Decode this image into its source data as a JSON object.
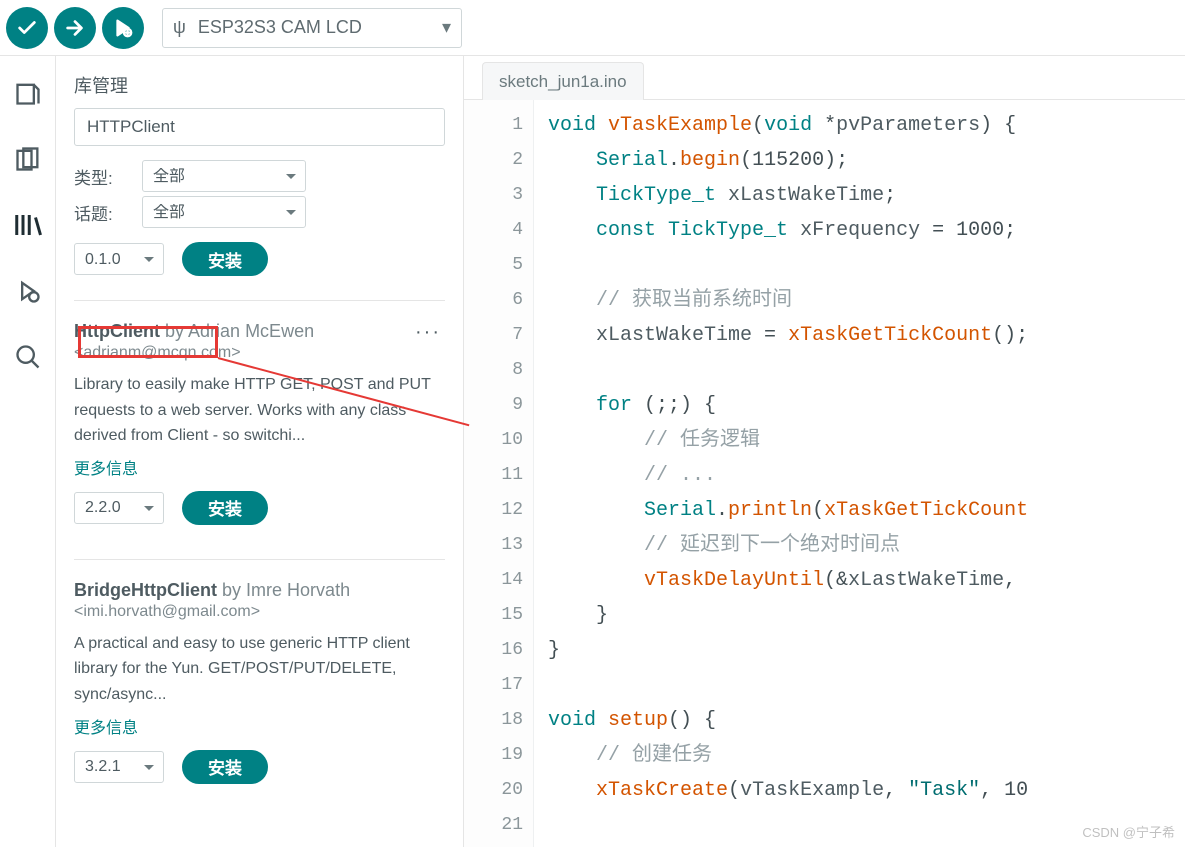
{
  "toolbar": {
    "board_name": "ESP32S3 CAM LCD"
  },
  "sidebar": {
    "title": "库管理",
    "search_value": "HTTPClient",
    "type_label": "类型:",
    "type_value": "全部",
    "topic_label": "话题:",
    "topic_value": "全部",
    "top_version": "0.1.0",
    "install_label": "安装",
    "libs": [
      {
        "name": "HttpClient",
        "by": "by",
        "author": "Adrian McEwen",
        "email": "<adrianm@mcqn.com>",
        "desc": "Library to easily make HTTP GET, POST and PUT requests to a web server. Works with any class derived from Client - so switchi...",
        "more": "更多信息",
        "version": "2.2.0"
      },
      {
        "name": "BridgeHttpClient",
        "by": "by",
        "author": "Imre Horvath",
        "email": "<imi.horvath@gmail.com>",
        "desc": "A practical and easy to use generic HTTP client library for the Yun. GET/POST/PUT/DELETE, sync/async...",
        "more": "更多信息",
        "version": "3.2.1"
      }
    ]
  },
  "editor": {
    "tab": "sketch_jun1a.ino",
    "lines": [
      {
        "n": 1,
        "tokens": [
          {
            "t": "void ",
            "c": "kw"
          },
          {
            "t": "vTaskExample",
            "c": "fn"
          },
          {
            "t": "(",
            "c": "op"
          },
          {
            "t": "void ",
            "c": "kw"
          },
          {
            "t": "*",
            "c": "op"
          },
          {
            "t": "pvParameters",
            "c": "ident"
          },
          {
            "t": ") {",
            "c": "op"
          }
        ]
      },
      {
        "n": 2,
        "indent": 4,
        "tokens": [
          {
            "t": "Serial",
            "c": "type"
          },
          {
            "t": ".",
            "c": "op"
          },
          {
            "t": "begin",
            "c": "fn"
          },
          {
            "t": "(",
            "c": "op"
          },
          {
            "t": "115200",
            "c": "num"
          },
          {
            "t": ");",
            "c": "op"
          }
        ]
      },
      {
        "n": 3,
        "indent": 4,
        "tokens": [
          {
            "t": "TickType_t ",
            "c": "type"
          },
          {
            "t": "xLastWakeTime",
            "c": "ident"
          },
          {
            "t": ";",
            "c": "op"
          }
        ]
      },
      {
        "n": 4,
        "indent": 4,
        "tokens": [
          {
            "t": "const ",
            "c": "kw"
          },
          {
            "t": "TickType_t ",
            "c": "type"
          },
          {
            "t": "xFrequency",
            "c": "ident"
          },
          {
            "t": " = ",
            "c": "op"
          },
          {
            "t": "1000",
            "c": "num"
          },
          {
            "t": ";",
            "c": "op"
          }
        ]
      },
      {
        "n": 5,
        "tokens": []
      },
      {
        "n": 6,
        "indent": 4,
        "tokens": [
          {
            "t": "// 获取当前系统时间",
            "c": "cm"
          }
        ]
      },
      {
        "n": 7,
        "indent": 4,
        "tokens": [
          {
            "t": "xLastWakeTime",
            "c": "ident"
          },
          {
            "t": " = ",
            "c": "op"
          },
          {
            "t": "xTaskGetTickCount",
            "c": "fn"
          },
          {
            "t": "();",
            "c": "op"
          }
        ]
      },
      {
        "n": 8,
        "tokens": []
      },
      {
        "n": 9,
        "indent": 4,
        "tokens": [
          {
            "t": "for ",
            "c": "kw"
          },
          {
            "t": "(;;) {",
            "c": "op"
          }
        ]
      },
      {
        "n": 10,
        "indent": 8,
        "tokens": [
          {
            "t": "// 任务逻辑",
            "c": "cm"
          }
        ]
      },
      {
        "n": 11,
        "indent": 8,
        "tokens": [
          {
            "t": "// ...",
            "c": "cm"
          }
        ]
      },
      {
        "n": 12,
        "indent": 8,
        "tokens": [
          {
            "t": "Serial",
            "c": "type"
          },
          {
            "t": ".",
            "c": "op"
          },
          {
            "t": "println",
            "c": "fn"
          },
          {
            "t": "(",
            "c": "op"
          },
          {
            "t": "xTaskGetTickCount",
            "c": "fn"
          }
        ]
      },
      {
        "n": 13,
        "indent": 8,
        "tokens": [
          {
            "t": "// 延迟到下一个绝对时间点",
            "c": "cm"
          }
        ]
      },
      {
        "n": 14,
        "indent": 8,
        "tokens": [
          {
            "t": "vTaskDelayUntil",
            "c": "fn"
          },
          {
            "t": "(&",
            "c": "op"
          },
          {
            "t": "xLastWakeTime",
            "c": "ident"
          },
          {
            "t": ", ",
            "c": "op"
          }
        ]
      },
      {
        "n": 15,
        "indent": 4,
        "tokens": [
          {
            "t": "}",
            "c": "op"
          }
        ]
      },
      {
        "n": 16,
        "tokens": [
          {
            "t": "}",
            "c": "op"
          }
        ]
      },
      {
        "n": 17,
        "tokens": []
      },
      {
        "n": 18,
        "tokens": [
          {
            "t": "void ",
            "c": "kw"
          },
          {
            "t": "setup",
            "c": "fn"
          },
          {
            "t": "() {",
            "c": "op"
          }
        ]
      },
      {
        "n": 19,
        "indent": 4,
        "tokens": [
          {
            "t": "// 创建任务",
            "c": "cm"
          }
        ]
      },
      {
        "n": 20,
        "indent": 4,
        "tokens": [
          {
            "t": "xTaskCreate",
            "c": "fn"
          },
          {
            "t": "(",
            "c": "op"
          },
          {
            "t": "vTaskExample",
            "c": "ident"
          },
          {
            "t": ", ",
            "c": "op"
          },
          {
            "t": "\"Task\"",
            "c": "str"
          },
          {
            "t": ", ",
            "c": "op"
          },
          {
            "t": "10",
            "c": "num"
          }
        ]
      },
      {
        "n": 21,
        "tokens": []
      }
    ]
  },
  "watermark": "CSDN @宁子希"
}
